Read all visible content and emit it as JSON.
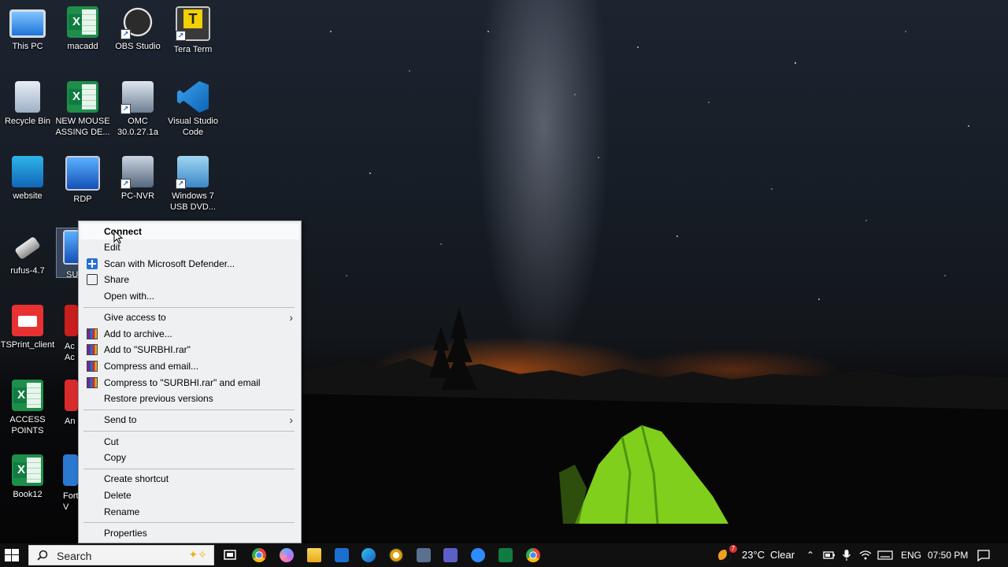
{
  "desktop": {
    "icons": [
      {
        "label": "This PC"
      },
      {
        "label": "macadd"
      },
      {
        "label": "OBS Studio"
      },
      {
        "label": "Tera Term"
      },
      {
        "label": "Recycle Bin"
      },
      {
        "label": "NEW MOUSE ASSING DE..."
      },
      {
        "label": "OMC 30.0.27.1a"
      },
      {
        "label": "Visual Studio Code"
      },
      {
        "label": "website"
      },
      {
        "label": "RDP"
      },
      {
        "label": "PC-NVR"
      },
      {
        "label": "Windows 7 USB DVD..."
      },
      {
        "label": "rufus-4.7"
      },
      {
        "label": "SU"
      },
      {
        "label": "TSPrint_client"
      },
      {
        "label": "Ac Ac"
      },
      {
        "label": "ACCESS POINTS"
      },
      {
        "label": "An"
      },
      {
        "label": "Book12"
      },
      {
        "label": "Fort V"
      }
    ]
  },
  "context_menu": {
    "connect": "Connect",
    "edit": "Edit",
    "scan": "Scan with Microsoft Defender...",
    "share": "Share",
    "open_with": "Open with...",
    "give_access": "Give access to",
    "add_archive": "Add to archive...",
    "add_rar": "Add to \"SURBHI.rar\"",
    "compress_email": "Compress and email...",
    "compress_rar_email": "Compress to \"SURBHI.rar\" and email",
    "restore": "Restore previous versions",
    "send_to": "Send to",
    "cut": "Cut",
    "copy": "Copy",
    "create_shortcut": "Create shortcut",
    "delete": "Delete",
    "rename": "Rename",
    "properties": "Properties",
    "submenu_arrow": "›"
  },
  "taskbar": {
    "search_placeholder": "Search",
    "weather_temp": "23°C",
    "weather_cond": "Clear",
    "weather_badge": "7",
    "language": "ENG",
    "time": "07:50 PM"
  }
}
